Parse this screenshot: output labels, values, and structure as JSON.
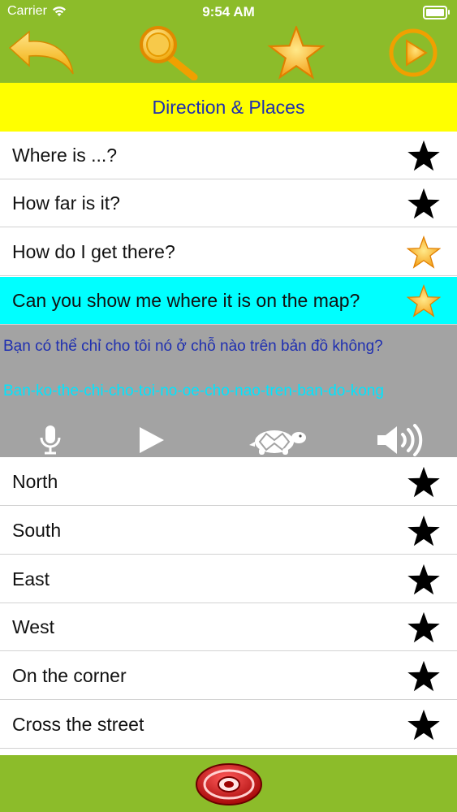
{
  "status": {
    "carrier": "Carrier",
    "time": "9:54 AM"
  },
  "toolbar": {
    "back_icon": "back-arrow-icon",
    "search_icon": "magnifier-icon",
    "favorite_icon": "star-icon",
    "play_icon": "play-circle-icon"
  },
  "title": "Direction & Places",
  "phrases_top": [
    {
      "label": "Where is ...?",
      "starred": false
    },
    {
      "label": "How far is it?",
      "starred": false
    },
    {
      "label": "How do I get there?",
      "starred": true
    },
    {
      "label": "Can you show me where it is on the map?",
      "starred": true,
      "selected": true
    }
  ],
  "detail": {
    "translation": "Bạn có thể chỉ cho tôi nó ở chỗ nào trên bản đồ không?",
    "pronunciation": "Ban-ko-the-chi-cho-toi-no-oe-cho-nao-tren-ban-do-kong",
    "controls": [
      "microphone-icon",
      "play-icon",
      "turtle-slow-icon",
      "speaker-icon"
    ]
  },
  "phrases_bottom": [
    {
      "label": "North",
      "starred": false
    },
    {
      "label": "South",
      "starred": false
    },
    {
      "label": "East",
      "starred": false
    },
    {
      "label": "West",
      "starred": false
    },
    {
      "label": "On the corner",
      "starred": false
    },
    {
      "label": "Cross the street",
      "starred": false
    }
  ],
  "footer": {
    "email_icon": "at-sign-email-icon"
  },
  "colors": {
    "header_green": "#8cbc2a",
    "title_yellow": "#ffff00",
    "title_text": "#1f2fb0",
    "selected_cyan": "#00ffff",
    "detail_gray": "#a3a3a3",
    "pron_cyan": "#00e5ff"
  }
}
